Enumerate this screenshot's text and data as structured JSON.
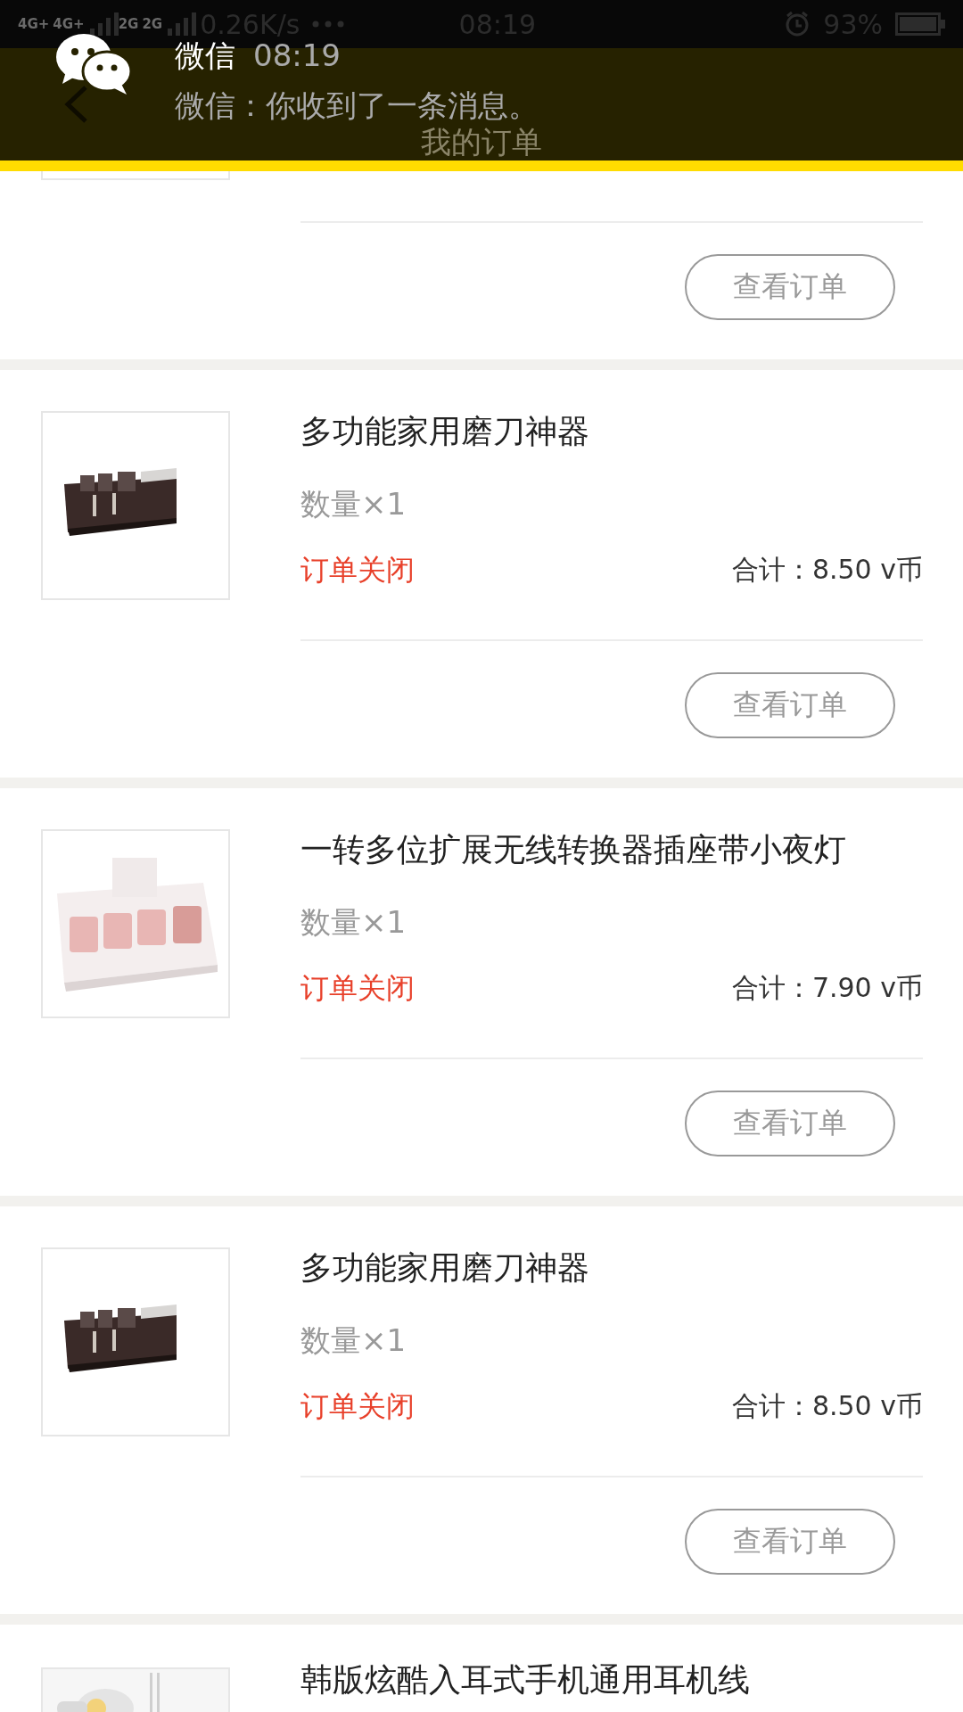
{
  "status_bar": {
    "network_labels": [
      "4G+",
      "4G+",
      "2G",
      "2G"
    ],
    "speed": "0.26K/s",
    "time": "08:19",
    "battery": "93%"
  },
  "notification": {
    "app": "微信",
    "time": "08:19",
    "message": "微信：你收到了一条消息。"
  },
  "header": {
    "title": "我的订单"
  },
  "orders": [
    {
      "kind": "partial",
      "button": "查看订单"
    },
    {
      "kind": "full",
      "title": "多功能家用磨刀神器",
      "quantity": "数量×1",
      "status": "订单关闭",
      "total": "合计：8.50 v币",
      "button": "查看订单"
    },
    {
      "kind": "full",
      "title": "一转多位扩展无线转换器插座带小夜灯",
      "quantity": "数量×1",
      "status": "订单关闭",
      "total": "合计：7.90 v币",
      "button": "查看订单"
    },
    {
      "kind": "full",
      "title": "多功能家用磨刀神器",
      "quantity": "数量×1",
      "status": "订单关闭",
      "total": "合计：8.50 v币",
      "button": "查看订单"
    },
    {
      "kind": "top",
      "title": "韩版炫酷入耳式手机通用耳机线"
    }
  ]
}
